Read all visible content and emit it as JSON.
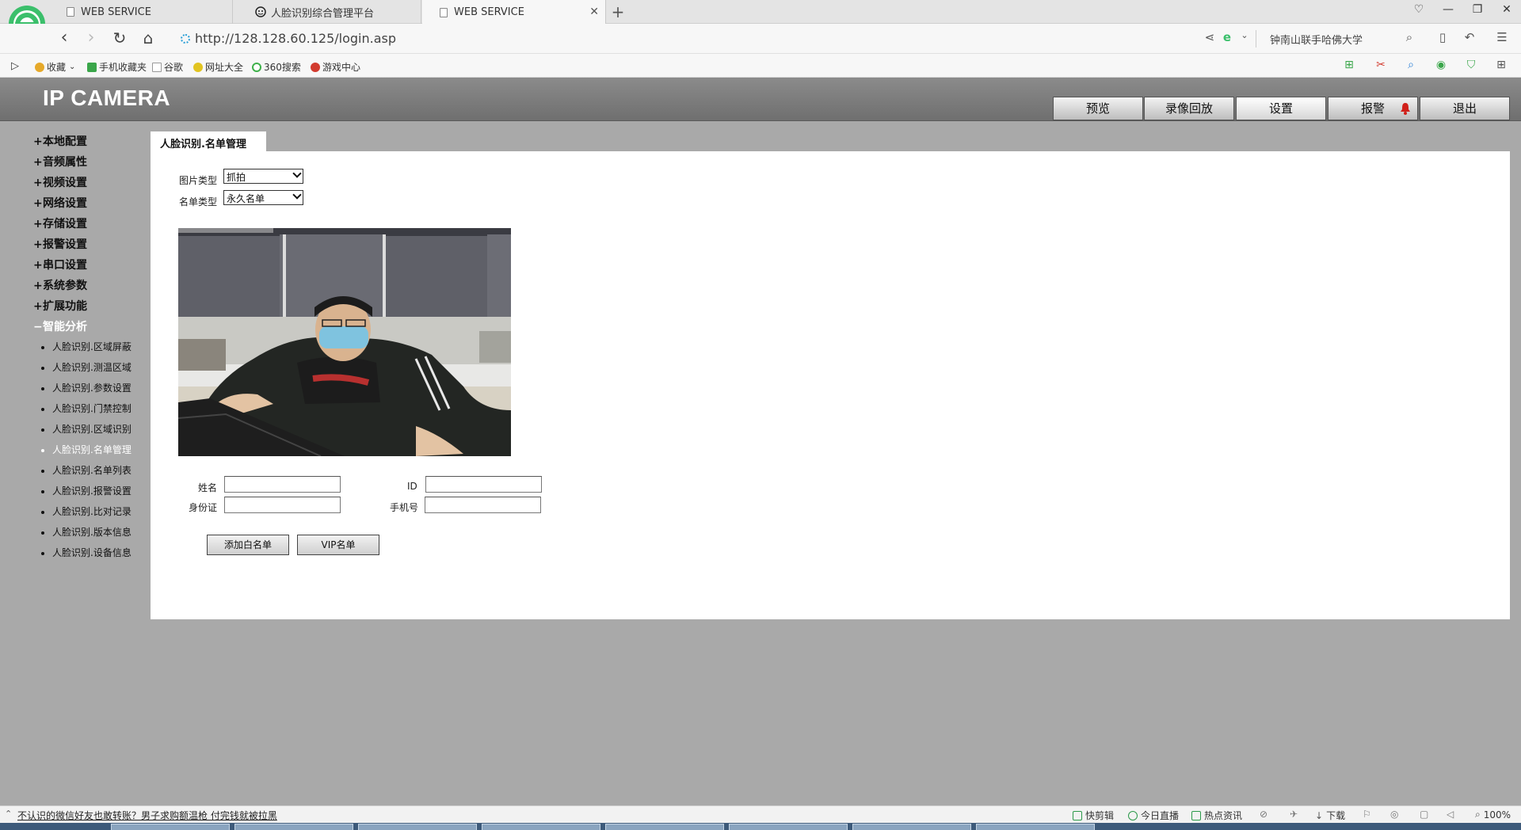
{
  "browser": {
    "tabs": [
      {
        "label": "WEB SERVICE"
      },
      {
        "label": "人脸识别综合管理平台"
      },
      {
        "label": "WEB SERVICE"
      }
    ],
    "new_tab_label": "+",
    "url": "http://128.128.60.125/login.asp",
    "search_text": "钟南山联手哈佛大学",
    "favorites": [
      {
        "label": "收藏",
        "color": "#e6a92a"
      },
      {
        "label": "手机收藏夹",
        "color": "#3aa64a"
      },
      {
        "label": "谷歌",
        "color": "#999999"
      },
      {
        "label": "网址大全",
        "color": "#e2c420"
      },
      {
        "label": "360搜索",
        "color": "#3fb14b"
      },
      {
        "label": "游戏中心",
        "color": "#d23b2f"
      }
    ]
  },
  "camera": {
    "title": "IP CAMERA",
    "nav": [
      {
        "label": "预览"
      },
      {
        "label": "录像回放"
      },
      {
        "label": "设置"
      },
      {
        "label": "报警"
      },
      {
        "label": "退出"
      }
    ],
    "sidebar": {
      "groups": [
        {
          "sign": "+",
          "label": "本地配置"
        },
        {
          "sign": "+",
          "label": "音频属性"
        },
        {
          "sign": "+",
          "label": "视频设置"
        },
        {
          "sign": "+",
          "label": "网络设置"
        },
        {
          "sign": "+",
          "label": "存储设置"
        },
        {
          "sign": "+",
          "label": "报警设置"
        },
        {
          "sign": "+",
          "label": "串口设置"
        },
        {
          "sign": "+",
          "label": "系统参数"
        },
        {
          "sign": "+",
          "label": "扩展功能"
        },
        {
          "sign": "−",
          "label": "智能分析"
        }
      ],
      "sub_items": [
        {
          "label": "人脸识别.区域屏蔽"
        },
        {
          "label": "人脸识别.测温区域"
        },
        {
          "label": "人脸识别.参数设置"
        },
        {
          "label": "人脸识别.门禁控制"
        },
        {
          "label": "人脸识别.区域识别"
        },
        {
          "label": "人脸识别.名单管理"
        },
        {
          "label": "人脸识别.名单列表"
        },
        {
          "label": "人脸识别.报警设置"
        },
        {
          "label": "人脸识别.比对记录"
        },
        {
          "label": "人脸识别.版本信息"
        },
        {
          "label": "人脸识别.设备信息"
        }
      ]
    },
    "content": {
      "tab_title": "人脸识别.名单管理",
      "image_type_label": "图片类型",
      "image_type_value": "抓拍",
      "list_type_label": "名单类型",
      "list_type_value": "永久名单",
      "name_label": "姓名",
      "name_value": "",
      "id_label": "ID",
      "id_value": "",
      "idcard_label": "身份证",
      "idcard_value": "",
      "phone_label": "手机号",
      "phone_value": "",
      "add_whitelist_button": "添加白名单",
      "vip_button": "VIP名单"
    }
  },
  "statusbar": {
    "news": "不认识的微信好友也敢转账？男子求购额温枪 付完钱就被拉黑",
    "items": [
      {
        "label": "快剪辑"
      },
      {
        "label": "今日直播"
      },
      {
        "label": "热点资讯"
      },
      {
        "label": "下载"
      },
      {
        "label": "100%"
      }
    ]
  }
}
